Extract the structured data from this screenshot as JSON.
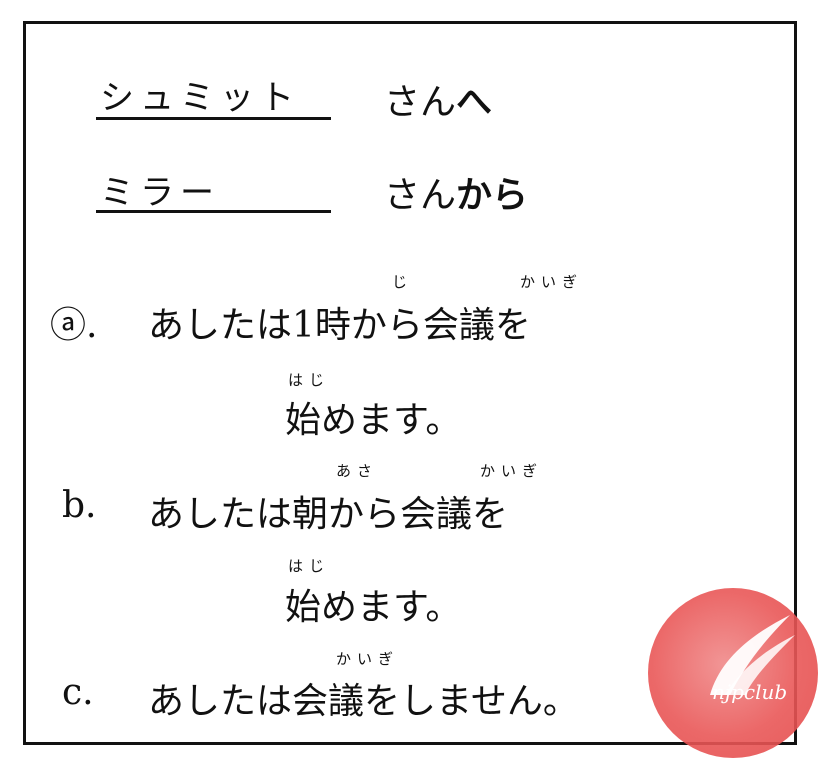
{
  "header": {
    "to_name": "シュミット",
    "to_suffix": "さん",
    "to_particle": "へ",
    "from_name": "ミラー",
    "from_suffix": "さん",
    "from_particle": "から"
  },
  "options": [
    {
      "label": "ⓐ.",
      "line1": "あしたは1時から会議を",
      "line2": "始めます。",
      "ruby1": [
        "じ",
        "かいぎ"
      ],
      "ruby2": [
        "はじ"
      ]
    },
    {
      "label": "b.",
      "line1": "あしたは朝から会議を",
      "line2": "始めます。",
      "ruby1": [
        "あさ",
        "かいぎ"
      ],
      "ruby2": [
        "はじ"
      ]
    },
    {
      "label": "c.",
      "line1": "あしたは会議をしません。",
      "ruby1": [
        "かいぎ"
      ]
    }
  ],
  "logo": {
    "text": "njpclub",
    "color": "#e95757"
  }
}
